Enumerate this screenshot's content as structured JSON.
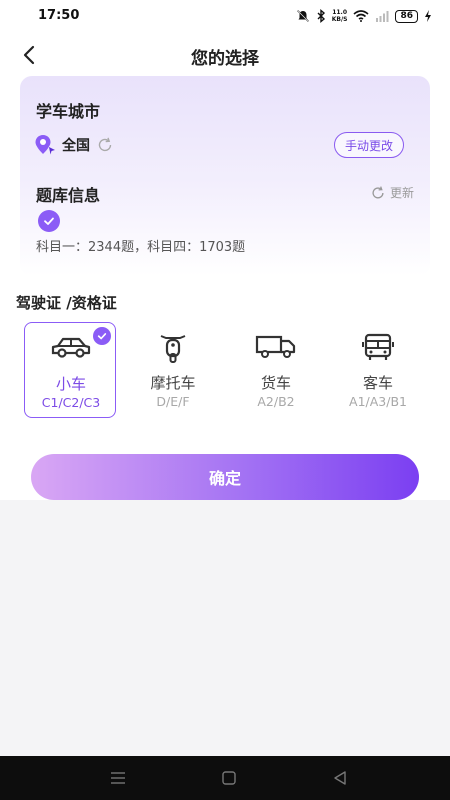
{
  "status_bar": {
    "time": "17:50",
    "net_speed_value": "11.0",
    "net_speed_unit": "KB/S",
    "battery": "86",
    "icons": [
      "mute-bell-icon",
      "bluetooth-icon",
      "wifi-icon",
      "signal-icon",
      "charging-icon"
    ]
  },
  "header": {
    "title": "您的选择",
    "back_icon": "chevron-left-icon"
  },
  "card": {
    "city_heading": "学车城市",
    "city_value": "全国",
    "change_button": "手动更改",
    "bank_heading": "题库信息",
    "update_label": "更新",
    "stats": "科目一：2344题，科目四：1703题"
  },
  "license": {
    "section_title": "驾驶证 /资格证",
    "types": [
      {
        "label": "小车",
        "sub": "C1/C2/C3",
        "icon": "car-icon",
        "selected": true
      },
      {
        "label": "摩托车",
        "sub": "D/E/F",
        "icon": "motorcycle-icon",
        "selected": false
      },
      {
        "label": "货车",
        "sub": "A2/B2",
        "icon": "truck-icon",
        "selected": false
      },
      {
        "label": "客车",
        "sub": "A1/A3/B1",
        "icon": "bus-icon",
        "selected": false
      }
    ]
  },
  "confirm_button": "确定",
  "colors": {
    "accent": "#8b5cf6",
    "button_gradient_start": "#d9a7f4",
    "button_gradient_end": "#7b3ff2"
  }
}
